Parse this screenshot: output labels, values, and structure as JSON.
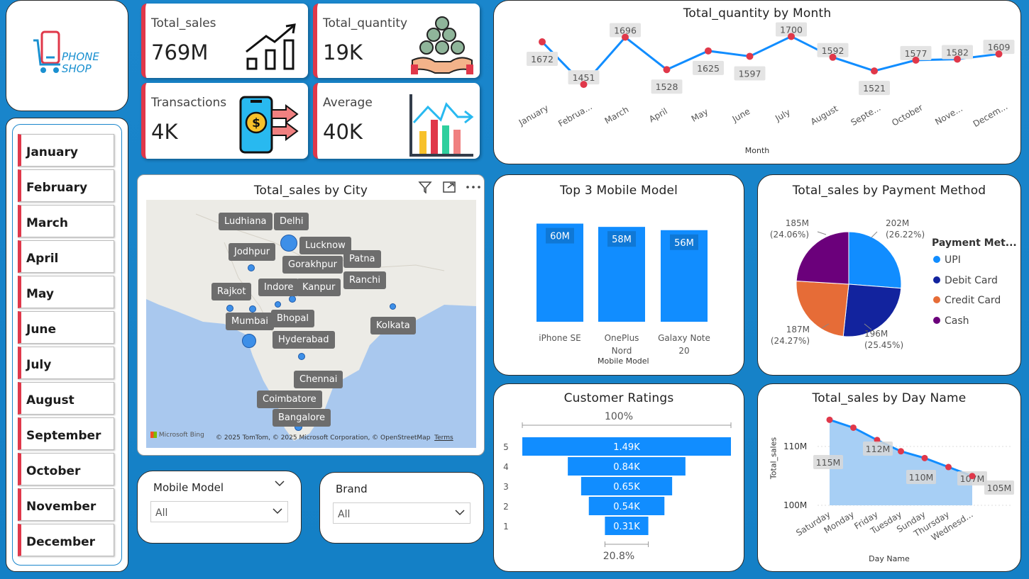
{
  "logo": {
    "line1": "PHONE",
    "line2": "SHOP"
  },
  "months": [
    "January",
    "February",
    "March",
    "April",
    "May",
    "June",
    "July",
    "August",
    "September",
    "October",
    "November",
    "December"
  ],
  "kpis": [
    {
      "label": "Total_sales",
      "value": "769M",
      "icon": "growth-chart-icon"
    },
    {
      "label": "Total_quantity",
      "value": "19K",
      "icon": "coins-hand-icon"
    },
    {
      "label": "Transactions",
      "value": "4K",
      "icon": "mobile-payment-icon"
    },
    {
      "label": "Average",
      "value": "40K",
      "icon": "bar-chart-icon"
    }
  ],
  "quantity_chart": {
    "title": "Total_quantity by Month",
    "xlabel": "Month",
    "tick_labels": [
      "January",
      "Februa...",
      "March",
      "April",
      "May",
      "June",
      "July",
      "August",
      "Septe...",
      "October",
      "Nove...",
      "Decem..."
    ]
  },
  "map": {
    "title": "Total_sales by City",
    "cities": [
      "Ludhiana",
      "Delhi",
      "Lucknow",
      "Jodhpur",
      "Patna",
      "Gorakhpur",
      "Ranchi",
      "Rajkot",
      "Indore",
      "Kanpur",
      "Bhopal",
      "Mumbai",
      "Kolkata",
      "Hyderabad",
      "Chennai",
      "Coimbatore",
      "Bangalore"
    ],
    "attribution": "© 2025 TomTom, © 2025 Microsoft Corporation, © OpenStreetMap",
    "terms": "Terms",
    "bing": "Microsoft Bing"
  },
  "top_models": {
    "title": "Top 3 Mobile Model",
    "xlabel": "Mobile Model"
  },
  "payment": {
    "title": "Total_sales by Payment Method",
    "legend_title": "Payment Met..."
  },
  "ratings": {
    "title": "Customer Ratings",
    "top_pct": "100%",
    "bottom_pct": "20.8%"
  },
  "dayname": {
    "title": "Total_sales by Day Name",
    "xlabel": "Day Name",
    "ylabel": "Total_sales",
    "y_ticks": [
      "110M",
      "100M"
    ]
  },
  "filters": {
    "model": {
      "label": "Mobile Model",
      "value": "All"
    },
    "brand": {
      "label": "Brand",
      "value": "All"
    }
  },
  "colors": {
    "accent": "#e0384a",
    "bar": "#118dff",
    "background": "#1a86cc"
  },
  "chart_data": [
    {
      "type": "line",
      "title": "Total_quantity by Month",
      "xlabel": "Month",
      "categories": [
        "January",
        "February",
        "March",
        "April",
        "May",
        "June",
        "July",
        "August",
        "September",
        "October",
        "November",
        "December"
      ],
      "values": [
        1672,
        1451,
        1696,
        1528,
        1625,
        1597,
        1700,
        1592,
        1521,
        1577,
        1582,
        1609
      ]
    },
    {
      "type": "bar",
      "title": "Top 3 Mobile Model",
      "xlabel": "Mobile Model",
      "categories": [
        "iPhone SE",
        "OnePlus Nord",
        "Galaxy Note 20"
      ],
      "values": [
        60,
        58,
        56
      ],
      "labels": [
        "60M",
        "58M",
        "56M"
      ]
    },
    {
      "type": "pie",
      "title": "Total_sales by Payment Method",
      "legend_title": "Payment Met...",
      "categories": [
        "UPI",
        "Debit Card",
        "Credit Card",
        "Cash"
      ],
      "values": [
        202,
        196,
        187,
        185
      ],
      "labels": [
        "202M",
        "196M",
        "187M",
        "185M"
      ],
      "percents": [
        "(26.22%)",
        "(25.45%)",
        "(24.27%)",
        "(24.06%)"
      ],
      "colors": [
        "#118dff",
        "#12239e",
        "#e66c37",
        "#6b007b"
      ],
      "legend_position": "right"
    },
    {
      "type": "bar",
      "orientation": "funnel",
      "title": "Customer Ratings",
      "categories": [
        "5",
        "4",
        "3",
        "2",
        "1"
      ],
      "values": [
        1490,
        840,
        650,
        540,
        310
      ],
      "labels": [
        "1.49K",
        "0.84K",
        "0.65K",
        "0.54K",
        "0.31K"
      ]
    },
    {
      "type": "area",
      "title": "Total_sales by Day Name",
      "xlabel": "Day Name",
      "ylabel": "Total_sales",
      "categories": [
        "Saturday",
        "Monday",
        "Friday",
        "Tuesday",
        "Sunday",
        "Thursday",
        "Wednesday"
      ],
      "tick_labels": [
        "Saturday",
        "Monday",
        "Friday",
        "Tuesday",
        "Sunday",
        "Thursday",
        "Wednesd..."
      ],
      "values": [
        115.2,
        113.8,
        111.6,
        109.6,
        108.4,
        106.8,
        105.2
      ],
      "labels": [
        "115M",
        "",
        "112M",
        "110M",
        "",
        "107M",
        "105M"
      ],
      "ylim": [
        100,
        116
      ]
    }
  ]
}
